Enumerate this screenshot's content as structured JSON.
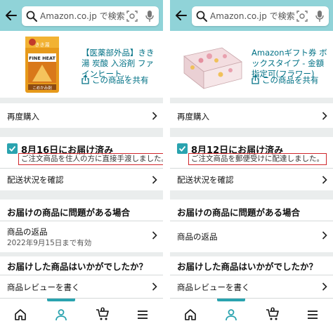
{
  "left": {
    "search": {
      "placeholder": "Amazon.co.jp で検索"
    },
    "product": {
      "name": "【医薬部外品】きき湯 炭酸 入浴剤 ファインヒート...",
      "share_label": "この商品を共有",
      "image_text_top": "きき湯",
      "image_text_brand": "FINE HEAT",
      "image_text_sub": "こめかみ剤"
    },
    "rebuy_label": "再度購入",
    "delivery": {
      "title": "8月16日にお届け済み",
      "note": "ご注文商品を住人の方に直接手渡しました。",
      "track_label": "配送状況を確認"
    },
    "problem": {
      "title": "お届けの商品に問題がある場合",
      "return_label": "商品の返品",
      "return_sub": "2022年9月15日まで有効"
    },
    "review": {
      "title": "お届けした商品はいかがでしたか？",
      "write_label": "商品レビューを書く"
    },
    "nav": {
      "cart_count": "0"
    }
  },
  "right": {
    "search": {
      "placeholder": "Amazon.co.jp で検索"
    },
    "product": {
      "name": "Amazonギフト券 ボックスタイプ - 金額指定可(フラワー)",
      "share_label": "この商品を共有"
    },
    "rebuy_label": "再度購入",
    "delivery": {
      "title": "8月12日にお届け済み",
      "note": "ご注文商品を郵便受けに配達しました。",
      "track_label": "配送状況を確認"
    },
    "problem": {
      "title": "お届けの商品に問題がある場合",
      "return_label": "商品の返品"
    },
    "review": {
      "title": "お届けした商品はいかがでしたか？",
      "write_label": "商品レビューを書く"
    },
    "nav": {
      "cart_count": "0"
    }
  },
  "colors": {
    "header": "#90d3d8",
    "link": "#007185",
    "accent": "#2aa3af",
    "highlight_border": "#d0262b",
    "background": "#eaeded"
  },
  "icons": [
    "back-arrow-icon",
    "search-icon",
    "camera-icon",
    "microphone-icon",
    "share-icon",
    "chevron-right-icon",
    "checkbox-checked-icon",
    "home-icon",
    "account-icon",
    "cart-icon",
    "menu-icon"
  ]
}
